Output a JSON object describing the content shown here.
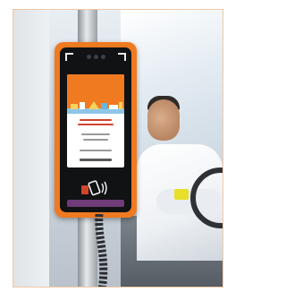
{
  "image": {
    "alt": "",
    "colors": {
      "validator_orange": "#f07a20",
      "validator_face": "#111214",
      "screen_white": "#ffffff",
      "nfc_purple": "#6f3b78",
      "driver_shirt": "#eef1f4",
      "frame_border": "#f0c8a4"
    },
    "icons": {
      "camera": "camera-icon",
      "contactless": "contactless-payment-icon",
      "card": "card-tap-icon"
    }
  }
}
